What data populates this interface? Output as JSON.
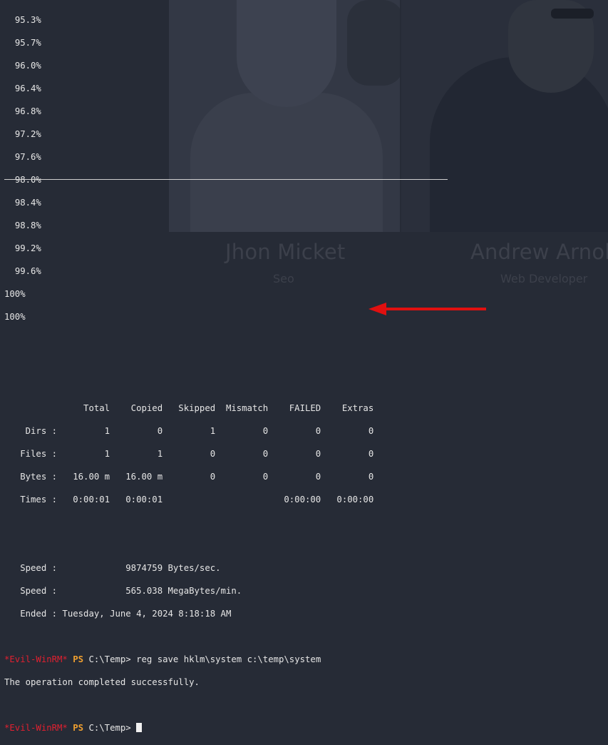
{
  "background": {
    "cards": [
      {
        "name": "Jhon Micket",
        "role": "Seo"
      },
      {
        "name": "Andrew Arnol",
        "role": "Web Developer"
      }
    ]
  },
  "terminal": {
    "progress": [
      "95.3%",
      "95.7%",
      "96.0%",
      "96.4%",
      "96.8%",
      "97.2%",
      "97.6%",
      "98.0%",
      "98.4%",
      "98.8%",
      "99.2%",
      "99.6%"
    ],
    "complete": [
      "100%",
      "100%"
    ],
    "stats_header": "               Total    Copied   Skipped  Mismatch    FAILED    Extras",
    "stats_rows": [
      "    Dirs :         1         0         1         0         0         0",
      "   Files :         1         1         0         0         0         0",
      "   Bytes :   16.00 m   16.00 m         0         0         0         0",
      "   Times :   0:00:01   0:00:01                       0:00:00   0:00:00"
    ],
    "summary": [
      "   Speed :             9874759 Bytes/sec.",
      "   Speed :             565.038 MegaBytes/min.",
      "   Ended : Tuesday, June 4, 2024 8:18:18 AM"
    ],
    "prompt_tag": "*Evil-WinRM*",
    "prompt_ps": "PS",
    "prompt_path": "C:\\Temp>",
    "command": "reg save hklm\\system c:\\temp\\system",
    "command_output": "The operation completed successfully.",
    "accent_colors": {
      "evil_winrm": "#e02030",
      "ps": "#f0a030",
      "arrow": "#e01010"
    }
  }
}
